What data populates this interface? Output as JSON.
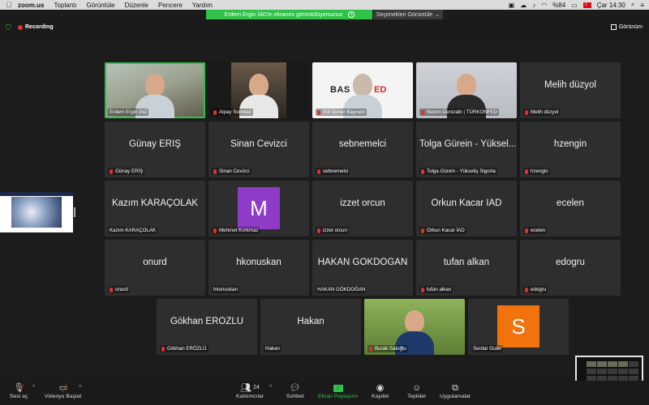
{
  "menubar": {
    "apple": "",
    "items": [
      "zoom.us",
      "Toplantı",
      "Görüntüle",
      "Düzenle",
      "Pencere",
      "Yardım"
    ],
    "battery": "%84",
    "clock": "Çar 14:30"
  },
  "share_banner": {
    "text": "Erdem Ergin İAD'in ekranını görüntülüyorsunuz",
    "view_options": "Seçenekleri Görüntüle"
  },
  "top": {
    "recording": "Recording",
    "view_button": "Görünüm"
  },
  "participants": [
    {
      "big": "",
      "label": "Erdem Ergin İAD",
      "muted": false,
      "kind": "video1",
      "active": true
    },
    {
      "big": "",
      "label": "Alpay Sonmez",
      "muted": true,
      "kind": "video2"
    },
    {
      "big": "",
      "label": "Elif Güner Bayındır",
      "muted": true,
      "kind": "video3",
      "logo": "BAS"
    },
    {
      "big": "",
      "label": "Nesrin Denizaltı | TÜRKONFED",
      "muted": true,
      "kind": "video4"
    },
    {
      "big": "Melih düzyol",
      "label": "Melih düzyol",
      "muted": true
    },
    {
      "big": "Günay ERİŞ",
      "label": "Günay ERİŞ",
      "muted": true
    },
    {
      "big": "Sinan Cevizci",
      "label": "Sinan Cevizci",
      "muted": true
    },
    {
      "big": "sebnemelci",
      "label": "sebnemelci",
      "muted": true
    },
    {
      "big": "Tolga Gürein - Yüksel...",
      "label": "Tolga Gürein - Yükseliş Sigorta",
      "muted": true
    },
    {
      "big": "hzengin",
      "label": "hzengin",
      "muted": true
    },
    {
      "big": "Kazım KARAÇOLAK",
      "label": "Kazım KARAÇOLAK",
      "muted": false
    },
    {
      "big": "",
      "label": "Mehmet Korkmaz",
      "muted": true,
      "avatar": "M",
      "avatar_color": "#8e3cc8"
    },
    {
      "big": "izzet orcun",
      "label": "izzet orcun",
      "muted": true
    },
    {
      "big": "Orkun Kacar İAD",
      "label": "Orkun Kacar İAD",
      "muted": true
    },
    {
      "big": "ecelen",
      "label": "ecelen",
      "muted": true
    },
    {
      "big": "onurd",
      "label": "onurd",
      "muted": true
    },
    {
      "big": "hkonuskan",
      "label": "hkonuskan",
      "muted": false
    },
    {
      "big": "HAKAN GÖKDOĞAN",
      "label": "HAKAN GÖKDOĞAN",
      "muted": false
    },
    {
      "big": "tufan alkan",
      "label": "tufan alkan",
      "muted": true
    },
    {
      "big": "edogru",
      "label": "edogru",
      "muted": true
    },
    {
      "big": "Gökhan ERÖZLÜ",
      "label": "Gökhan ERÖZLÜ",
      "muted": true
    },
    {
      "big": "Hakan",
      "label": "Hakan",
      "muted": false
    },
    {
      "big": "",
      "label": "Burak Satoğlu",
      "muted": true,
      "kind": "video5"
    },
    {
      "big": "",
      "label": "Serdar Guler",
      "muted": false,
      "avatar": "S",
      "avatar_color": "#f2720c"
    }
  ],
  "toolbar": {
    "audio": "Sesi aç",
    "video": "Videoyu Başlat",
    "participants": "Katılımcılar",
    "participants_count": "24",
    "chat": "Sohbet",
    "share": "Ekran Paylaşımı",
    "record": "Kaydet",
    "reactions": "Tepkiler",
    "apps": "Uygulamalar"
  }
}
